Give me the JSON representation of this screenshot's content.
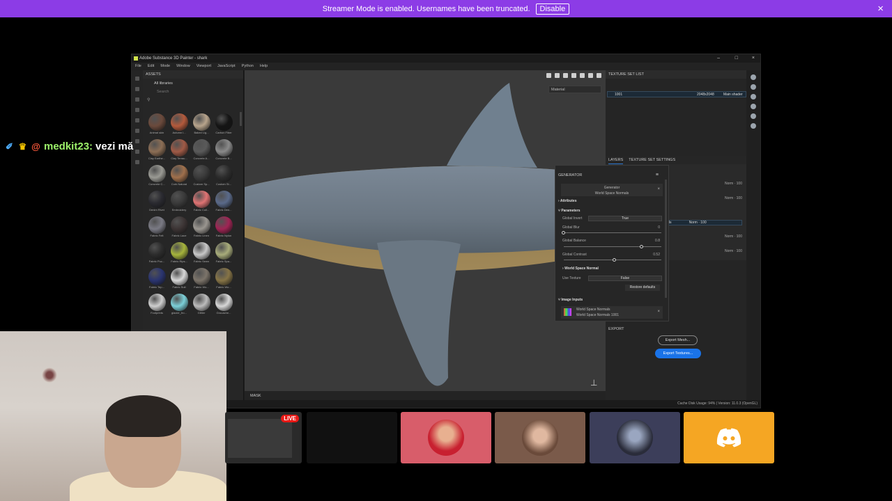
{
  "banner": {
    "text": "Streamer Mode is enabled. Usernames have been truncated.",
    "disable_label": "Disable",
    "close_icon": "×"
  },
  "app": {
    "title": "Adobe Substance 3D Painter - shark",
    "window_controls": [
      "–",
      "□",
      "×"
    ],
    "menu": [
      "File",
      "Edit",
      "Mode",
      "Window",
      "Viewport",
      "JavaScript",
      "Python",
      "Help"
    ]
  },
  "assets": {
    "header": "ASSETS",
    "library": "All libraries",
    "search_placeholder": "Search",
    "items": [
      {
        "label": "Animal skin",
        "color": "#6b4a3c"
      },
      {
        "label": "Autumn l...",
        "color": "#b45a3c"
      },
      {
        "label": "Baked Lig...",
        "color": "#b8a48c"
      },
      {
        "label": "Carbon Fiber",
        "color": "#151515"
      },
      {
        "label": "Clay Earthe...",
        "color": "#8c6e55"
      },
      {
        "label": "Clay Terrac...",
        "color": "#a05a46"
      },
      {
        "label": "Concrete A...",
        "color": "#5a5a5a"
      },
      {
        "label": "Concrete B...",
        "color": "#8a8a8a"
      },
      {
        "label": "Concrete C...",
        "color": "#9a9a94"
      },
      {
        "label": "Cork Natural",
        "color": "#a0704c"
      },
      {
        "label": "Custom Sp...",
        "color": "#3a3a3a"
      },
      {
        "label": "Custom St...",
        "color": "#2c2c2c"
      },
      {
        "label": "Denim Rivet",
        "color": "#2a2a30"
      },
      {
        "label": "Embroidery",
        "color": "#3a3a3a"
      },
      {
        "label": "Fabric Coll...",
        "color": "#e07474"
      },
      {
        "label": "Fabric Den...",
        "color": "#5a6a8a"
      },
      {
        "label": "Fabric Felt",
        "color": "#7a7a84"
      },
      {
        "label": "Fabric Lace",
        "color": "#3c3434"
      },
      {
        "label": "Fabric Linen",
        "color": "#9a9690"
      },
      {
        "label": "Fabric Nylon",
        "color": "#a02454"
      },
      {
        "label": "Fabric Puc...",
        "color": "#2c2c2c"
      },
      {
        "label": "Fabric Rips...",
        "color": "#a6b43c"
      },
      {
        "label": "Fabric Sewn",
        "color": "#c8c8c8"
      },
      {
        "label": "Fabric Spa...",
        "color": "#a8ac7a"
      },
      {
        "label": "Fabric Tep...",
        "color": "#2a3470"
      },
      {
        "label": "Fabric Suit",
        "color": "#d8d8d8"
      },
      {
        "label": "Fabric Wo...",
        "color": "#7c746a"
      },
      {
        "label": "Fabric Wo...",
        "color": "#867446"
      },
      {
        "label": "Footprints",
        "color": "#cfcfcf"
      },
      {
        "label": "glacier_fro...",
        "color": "#7cd0d8"
      },
      {
        "label": "Glitter",
        "color": "#bcbcbc"
      },
      {
        "label": "Grouache...",
        "color": "#d8d8d8"
      }
    ]
  },
  "viewport": {
    "material_select": "Material",
    "mask_label": "MASK"
  },
  "texture_set_list": {
    "header": "TEXTURE SET LIST",
    "row_name": "1001",
    "row_res": "2048x2048",
    "row_shader": "Main shader"
  },
  "layers": {
    "tab_layers": "LAYERS",
    "tab_settings": "TEXTURE SET SETTINGS",
    "rows": [
      {
        "blend": "Norm",
        "opacity": "100"
      },
      {
        "blend": "Norm",
        "opacity": "100"
      },
      {
        "blend": "Norm",
        "opacity": "100"
      },
      {
        "blend": "Norm",
        "opacity": "100"
      },
      {
        "blend": "Norm",
        "opacity": "100"
      }
    ],
    "selected_label": "mals",
    "selected_blend": "Norm",
    "selected_opacity": "100"
  },
  "properties": {
    "export_header": "EXPORT",
    "export_mesh": "Export Mesh...",
    "export_textures": "Export Textures...",
    "status": "Cache Disk Usage: 94% | Version: 11.0.3 (OpenGL)"
  },
  "generator": {
    "title": "GENERATOR",
    "card_title": "Generator",
    "card_sub": "World Space Normals",
    "attributes": "Attributes",
    "parameters": "Parameters",
    "global_invert_label": "Global Invert",
    "global_invert_value": "True",
    "global_blur_label": "Global Blur",
    "global_blur_value": "0",
    "global_balance_label": "Global Balance",
    "global_balance_value": "0.8",
    "global_contrast_label": "Global Contrast",
    "global_contrast_value": "0.52",
    "world_space_normal": "World Space Normal",
    "use_texture_label": "Use Texture",
    "use_texture_value": "False",
    "restore_defaults": "Restore defaults",
    "image_inputs": "Image Inputs",
    "input_title": "World Space Normals",
    "input_sub": "World Space Normals 1001",
    "sliders": {
      "blur": 0.0,
      "balance": 0.8,
      "contrast": 0.52
    }
  },
  "chat": {
    "username": "medkit23:",
    "message": "vezi mă"
  },
  "tiles": {
    "live_label": "LIVE"
  }
}
